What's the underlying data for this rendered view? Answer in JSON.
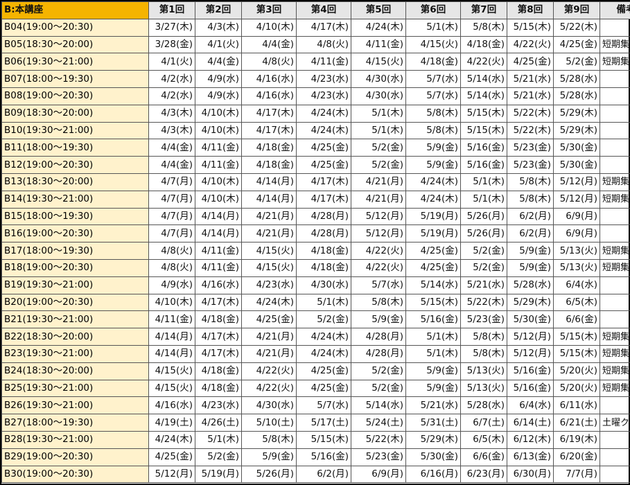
{
  "header": {
    "first_col": "B:本講座",
    "sessions": [
      "第1回",
      "第2回",
      "第3回",
      "第4回",
      "第5回",
      "第6回",
      "第7回",
      "第8回",
      "第9回"
    ],
    "note_col": "備考"
  },
  "rows": [
    {
      "name": "B04(19:00～20:30)",
      "dates": [
        "3/27(木)",
        "4/3(木)",
        "4/10(木)",
        "4/17(木)",
        "4/24(木)",
        "5/1(木)",
        "5/8(木)",
        "5/15(木)",
        "5/22(木)"
      ],
      "note": ""
    },
    {
      "name": "B05(18:30～20:00)",
      "dates": [
        "3/28(金)",
        "4/1(火)",
        "4/4(金)",
        "4/8(火)",
        "4/11(金)",
        "4/15(火)",
        "4/18(金)",
        "4/22(火)",
        "4/25(金)"
      ],
      "note": "短期集中"
    },
    {
      "name": "B06(19:30～21:00)",
      "dates": [
        "4/1(火)",
        "4/4(金)",
        "4/8(火)",
        "4/11(金)",
        "4/15(火)",
        "4/18(金)",
        "4/22(火)",
        "4/25(金)",
        "5/2(金)"
      ],
      "note": "短期集中"
    },
    {
      "name": "B07(18:00～19:30)",
      "dates": [
        "4/2(水)",
        "4/9(水)",
        "4/16(水)",
        "4/23(水)",
        "4/30(水)",
        "5/7(水)",
        "5/14(水)",
        "5/21(水)",
        "5/28(水)"
      ],
      "note": ""
    },
    {
      "name": "B08(19:00～20:30)",
      "dates": [
        "4/2(水)",
        "4/9(水)",
        "4/16(水)",
        "4/23(水)",
        "4/30(水)",
        "5/7(水)",
        "5/14(水)",
        "5/21(水)",
        "5/28(水)"
      ],
      "note": ""
    },
    {
      "name": "B09(18:30～20:00)",
      "dates": [
        "4/3(木)",
        "4/10(木)",
        "4/17(木)",
        "4/24(木)",
        "5/1(木)",
        "5/8(木)",
        "5/15(木)",
        "5/22(木)",
        "5/29(木)"
      ],
      "note": ""
    },
    {
      "name": "B10(19:30～21:00)",
      "dates": [
        "4/3(木)",
        "4/10(木)",
        "4/17(木)",
        "4/24(木)",
        "5/1(木)",
        "5/8(木)",
        "5/15(木)",
        "5/22(木)",
        "5/29(木)"
      ],
      "note": ""
    },
    {
      "name": "B11(18:00～19:30)",
      "dates": [
        "4/4(金)",
        "4/11(金)",
        "4/18(金)",
        "4/25(金)",
        "5/2(金)",
        "5/9(金)",
        "5/16(金)",
        "5/23(金)",
        "5/30(金)"
      ],
      "note": ""
    },
    {
      "name": "B12(19:00～20:30)",
      "dates": [
        "4/4(金)",
        "4/11(金)",
        "4/18(金)",
        "4/25(金)",
        "5/2(金)",
        "5/9(金)",
        "5/16(金)",
        "5/23(金)",
        "5/30(金)"
      ],
      "note": ""
    },
    {
      "name": "B13(18:30～20:00)",
      "dates": [
        "4/7(月)",
        "4/10(木)",
        "4/14(月)",
        "4/17(木)",
        "4/21(月)",
        "4/24(木)",
        "5/1(木)",
        "5/8(木)",
        "5/12(月)"
      ],
      "note": "短期集中"
    },
    {
      "name": "B14(19:30～21:00)",
      "dates": [
        "4/7(月)",
        "4/10(木)",
        "4/14(月)",
        "4/17(木)",
        "4/21(月)",
        "4/24(木)",
        "5/1(木)",
        "5/8(木)",
        "5/12(月)"
      ],
      "note": "短期集中"
    },
    {
      "name": "B15(18:00～19:30)",
      "dates": [
        "4/7(月)",
        "4/14(月)",
        "4/21(月)",
        "4/28(月)",
        "5/12(月)",
        "5/19(月)",
        "5/26(月)",
        "6/2(月)",
        "6/9(月)"
      ],
      "note": ""
    },
    {
      "name": "B16(19:00～20:30)",
      "dates": [
        "4/7(月)",
        "4/14(月)",
        "4/21(月)",
        "4/28(月)",
        "5/12(月)",
        "5/19(月)",
        "5/26(月)",
        "6/2(月)",
        "6/9(月)"
      ],
      "note": ""
    },
    {
      "name": "B17(18:00～19:30)",
      "dates": [
        "4/8(火)",
        "4/11(金)",
        "4/15(火)",
        "4/18(金)",
        "4/22(火)",
        "4/25(金)",
        "5/2(金)",
        "5/9(金)",
        "5/13(火)"
      ],
      "note": "短期集中"
    },
    {
      "name": "B18(19:00～20:30)",
      "dates": [
        "4/8(火)",
        "4/11(金)",
        "4/15(火)",
        "4/18(金)",
        "4/22(火)",
        "4/25(金)",
        "5/2(金)",
        "5/9(金)",
        "5/13(火)"
      ],
      "note": "短期集中"
    },
    {
      "name": "B19(19:30～21:00)",
      "dates": [
        "4/9(水)",
        "4/16(水)",
        "4/23(水)",
        "4/30(水)",
        "5/7(水)",
        "5/14(水)",
        "5/21(水)",
        "5/28(水)",
        "6/4(水)"
      ],
      "note": ""
    },
    {
      "name": "B20(19:00～20:30)",
      "dates": [
        "4/10(木)",
        "4/17(木)",
        "4/24(木)",
        "5/1(木)",
        "5/8(木)",
        "5/15(木)",
        "5/22(木)",
        "5/29(木)",
        "6/5(木)"
      ],
      "note": ""
    },
    {
      "name": "B21(19:30～21:00)",
      "dates": [
        "4/11(金)",
        "4/18(金)",
        "4/25(金)",
        "5/2(金)",
        "5/9(金)",
        "5/16(金)",
        "5/23(金)",
        "5/30(金)",
        "6/6(金)"
      ],
      "note": ""
    },
    {
      "name": "B22(18:30～20:00)",
      "dates": [
        "4/14(月)",
        "4/17(木)",
        "4/21(月)",
        "4/24(木)",
        "4/28(月)",
        "5/1(木)",
        "5/8(木)",
        "5/12(月)",
        "5/15(木)"
      ],
      "note": "短期集中"
    },
    {
      "name": "B23(19:30～21:00)",
      "dates": [
        "4/14(月)",
        "4/17(木)",
        "4/21(月)",
        "4/24(木)",
        "4/28(月)",
        "5/1(木)",
        "5/8(木)",
        "5/12(月)",
        "5/15(木)"
      ],
      "note": "短期集中"
    },
    {
      "name": "B24(18:30～20:00)",
      "dates": [
        "4/15(火)",
        "4/18(金)",
        "4/22(火)",
        "4/25(金)",
        "5/2(金)",
        "5/9(金)",
        "5/13(火)",
        "5/16(金)",
        "5/20(火)"
      ],
      "note": "短期集中"
    },
    {
      "name": "B25(19:30～21:00)",
      "dates": [
        "4/15(火)",
        "4/18(金)",
        "4/22(火)",
        "4/25(金)",
        "5/2(金)",
        "5/9(金)",
        "5/13(火)",
        "5/16(金)",
        "5/20(火)"
      ],
      "note": "短期集中"
    },
    {
      "name": "B26(19:30～21:00)",
      "dates": [
        "4/16(水)",
        "4/23(水)",
        "4/30(水)",
        "5/7(水)",
        "5/14(水)",
        "5/21(水)",
        "5/28(水)",
        "6/4(水)",
        "6/11(水)"
      ],
      "note": ""
    },
    {
      "name": "B27(18:00～19:30)",
      "dates": [
        "4/19(土)",
        "4/26(土)",
        "5/10(土)",
        "5/17(土)",
        "5/24(土)",
        "5/31(土)",
        "6/7(土)",
        "6/14(土)",
        "6/21(土)"
      ],
      "note": "土曜クラス"
    },
    {
      "name": "B28(19:30～21:00)",
      "dates": [
        "4/24(木)",
        "5/1(木)",
        "5/8(木)",
        "5/15(木)",
        "5/22(木)",
        "5/29(木)",
        "6/5(木)",
        "6/12(木)",
        "6/19(木)"
      ],
      "note": ""
    },
    {
      "name": "B29(19:00～20:30)",
      "dates": [
        "4/25(金)",
        "5/2(金)",
        "5/9(金)",
        "5/16(金)",
        "5/23(金)",
        "5/30(金)",
        "6/6(金)",
        "6/13(金)",
        "6/20(金)"
      ],
      "note": ""
    },
    {
      "name": "B30(19:00～20:30)",
      "dates": [
        "5/12(月)",
        "5/19(月)",
        "5/26(月)",
        "6/2(月)",
        "6/9(月)",
        "6/16(月)",
        "6/23(月)",
        "6/30(月)",
        "7/7(月)"
      ],
      "note": ""
    }
  ]
}
